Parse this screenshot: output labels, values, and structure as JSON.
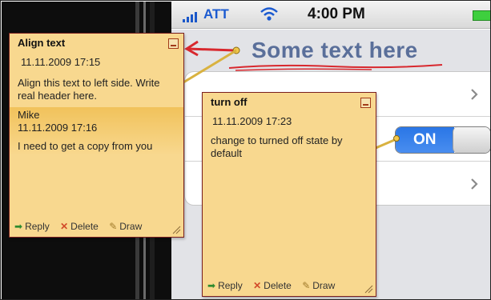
{
  "status_bar": {
    "carrier": "ATT",
    "time": "4:00 PM"
  },
  "screen": {
    "heading_annotation": "Some text here",
    "toggle_label": "ON"
  },
  "notes": [
    {
      "title": "Align text",
      "date": "11.11.2009 17:15",
      "body": "Align this text to left side. Write real header here.",
      "reply": {
        "author": "Mike",
        "date": "11.11.2009 17:16",
        "body": "I need  to get a copy from you"
      },
      "actions": {
        "reply": "Reply",
        "delete": "Delete",
        "draw": "Draw"
      }
    },
    {
      "title": "turn off",
      "date": "11.11.2009 17:23",
      "body": "change to turned off state by default",
      "actions": {
        "reply": "Reply",
        "delete": "Delete",
        "draw": "Draw"
      }
    }
  ],
  "colors": {
    "note_fill": "#f8d88f",
    "note_border": "#7a1f1f",
    "toggle_on": "#2a76e6",
    "annotation_red": "#d8282e"
  }
}
